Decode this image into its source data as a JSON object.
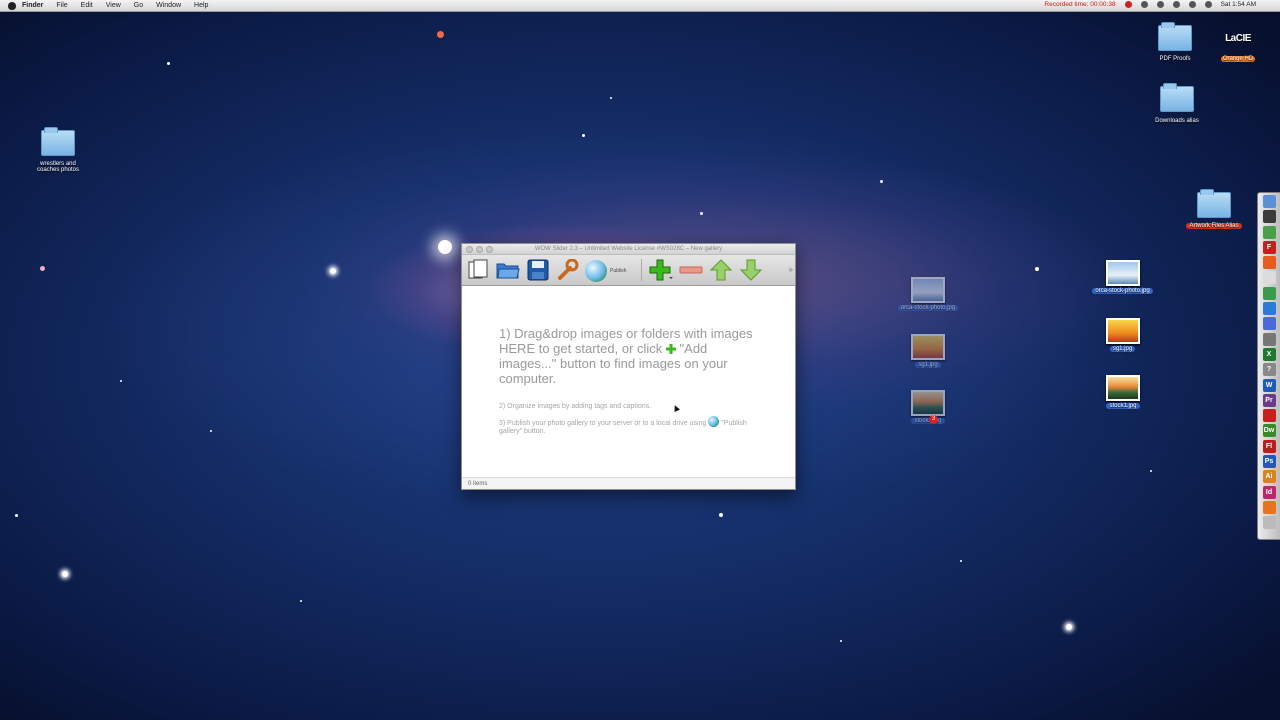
{
  "menubar": {
    "app": "Finder",
    "items": [
      "File",
      "Edit",
      "View",
      "Go",
      "Window",
      "Help"
    ],
    "recorded": "Recorded time: 00:00:38",
    "clock": "Sat 1:54 AM"
  },
  "desktop": {
    "wrestlers_folder": "wrestlers and coaches photos",
    "pdf_proofs": "PDF Proofs",
    "lacie_logo": "LaCIE",
    "orange_hd": "Orange HD",
    "downloads_alias": "Downloads alias",
    "artwork_alias": "Artwork Files Alias",
    "orca_photo": "orca-stock-photo.jpg",
    "sg1": "sg1.jpg",
    "stock1": "stock1.jpg",
    "drag_orca": "orca-stock-photo.jpg",
    "drag_sg1": "sg1.jpg",
    "drag_stock1": "stock1.jpg",
    "drag_count": "3"
  },
  "window": {
    "title": "WOW Slider 2.3 – Unlimited Website License #WS028C – New gallery",
    "toolbar": {
      "publish": "Publish"
    },
    "step1": "1) Drag&drop images or folders with images HERE to get started, or click",
    "step1b": "\"Add images...\" button to find images on your computer.",
    "step2": "2) Organize images by adding tags and captions.",
    "step3": "3) Publish your photo gallery to your server or to a local drive using",
    "step3b": "\"Publish gallery\" button.",
    "status": "0 items"
  },
  "dock": {
    "items": [
      {
        "icon": "finder-icon",
        "color": "#5b8fd8",
        "label": ""
      },
      {
        "icon": "dashboard-icon",
        "color": "#3a3a3a",
        "label": ""
      },
      {
        "icon": "maps-icon",
        "color": "#4aa04a",
        "label": ""
      },
      {
        "icon": "filezilla-icon",
        "color": "#c81e1e",
        "label": "F"
      },
      {
        "icon": "firefox-alt-icon",
        "color": "#e85a1e",
        "label": ""
      },
      {
        "icon": "preview-icon",
        "color": "#dcdcdc",
        "label": ""
      },
      {
        "icon": "chrome-icon",
        "color": "#3c9a4c",
        "label": ""
      },
      {
        "icon": "safari-icon",
        "color": "#2a7ad8",
        "label": ""
      },
      {
        "icon": "system-prefs-icon",
        "color": "#4a6ad8",
        "label": ""
      },
      {
        "icon": "tool-icon",
        "color": "#777",
        "label": ""
      },
      {
        "icon": "excel-icon",
        "color": "#1e7a2e",
        "label": "X"
      },
      {
        "icon": "help-icon",
        "color": "#888",
        "label": "?"
      },
      {
        "icon": "word-icon",
        "color": "#1e5ab8",
        "label": "W"
      },
      {
        "icon": "premiere-icon",
        "color": "#6a3a8a",
        "label": "Pr"
      },
      {
        "icon": "acrobat-icon",
        "color": "#c81e1e",
        "label": ""
      },
      {
        "icon": "dreamweaver-icon",
        "color": "#3a8a2a",
        "label": "Dw"
      },
      {
        "icon": "flash-icon",
        "color": "#b81e1e",
        "label": "Fl"
      },
      {
        "icon": "photoshop-icon",
        "color": "#1e5ab8",
        "label": "Ps"
      },
      {
        "icon": "illustrator-icon",
        "color": "#d8841e",
        "label": "Ai"
      },
      {
        "icon": "indesign-icon",
        "color": "#b8286a",
        "label": "Id"
      },
      {
        "icon": "firefox-icon",
        "color": "#e8741e",
        "label": ""
      },
      {
        "icon": "trash-icon",
        "color": "#bbb",
        "label": ""
      }
    ]
  }
}
